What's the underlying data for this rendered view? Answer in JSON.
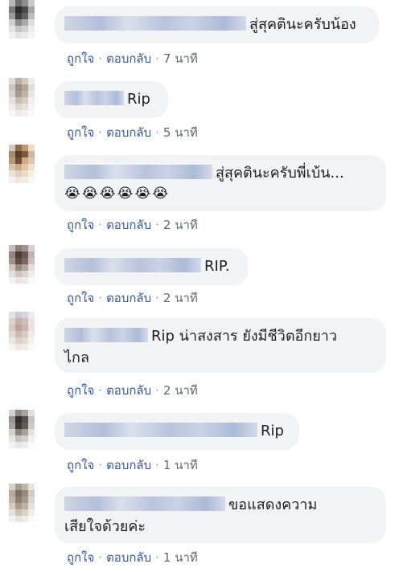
{
  "comments": [
    {
      "text": "สู่สุคตินะครับน้อง",
      "emoji": "",
      "actions": {
        "like": "ถูกใจ",
        "reply": "ตอบกลับ",
        "time": "7 นาที"
      }
    },
    {
      "text": "Rip",
      "emoji": "",
      "actions": {
        "like": "ถูกใจ",
        "reply": "ตอบกลับ",
        "time": "5 นาที"
      }
    },
    {
      "text": "สู่สุคตินะครับพี่เบ้น...",
      "emoji": "😭😭😭😭😭😭",
      "actions": {
        "like": "ถูกใจ",
        "reply": "ตอบกลับ",
        "time": "2 นาที"
      }
    },
    {
      "text": "RIP.",
      "emoji": "",
      "actions": {
        "like": "ถูกใจ",
        "reply": "ตอบกลับ",
        "time": "2 นาที"
      }
    },
    {
      "text": "Rip น่าสงสาร ยังมีชีวิตอีกยาว",
      "text2": "ไกล",
      "emoji": "",
      "actions": {
        "like": "ถูกใจ",
        "reply": "ตอบกลับ",
        "time": "2 นาที"
      }
    },
    {
      "text": "Rip",
      "emoji": "",
      "actions": {
        "like": "ถูกใจ",
        "reply": "ตอบกลับ",
        "time": "1 นาที"
      }
    },
    {
      "text": "ขอแสดงความ",
      "text2": "เสียใจด้วยค่ะ",
      "emoji": "",
      "actions": {
        "like": "ถูกใจ",
        "reply": "ตอบกลับ",
        "time": "1 นาที"
      }
    }
  ],
  "separator": "·"
}
